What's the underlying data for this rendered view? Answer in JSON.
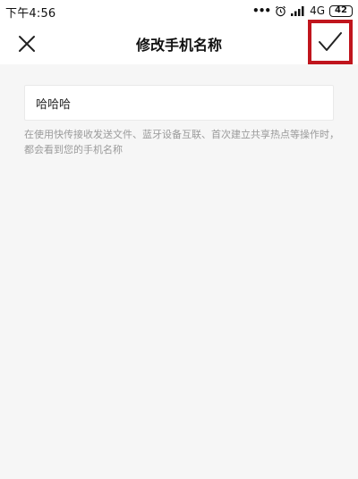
{
  "status_bar": {
    "time": "下午4:56",
    "dots": "•••",
    "network": "4G",
    "battery": "42"
  },
  "nav": {
    "title": "修改手机名称"
  },
  "form": {
    "name_value": "哈哈哈",
    "hint": "在使用快传接收发送文件、蓝牙设备互联、首次建立共享热点等操作时，都会看到您的手机名称"
  },
  "colors": {
    "highlight_border": "#c0151d",
    "content_background": "#f6f6f6",
    "hint_text": "#9a9a9a"
  },
  "icons": {
    "close": "close-icon",
    "confirm": "checkmark-icon",
    "alarm": "alarm-clock-icon",
    "signal": "signal-icon"
  }
}
